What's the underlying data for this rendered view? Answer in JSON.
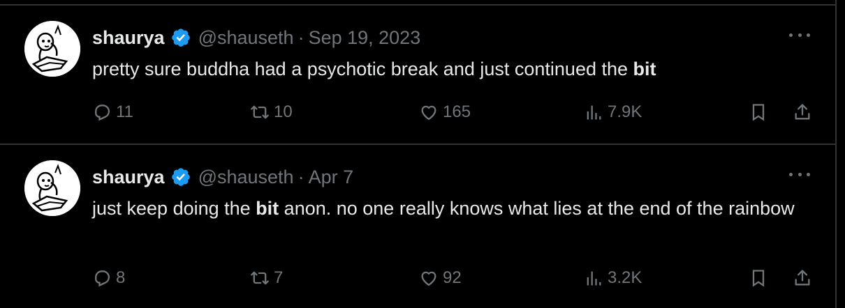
{
  "colors": {
    "background": "#000000",
    "divider": "#2f3336",
    "text_primary": "#e7e9ea",
    "text_secondary": "#71767b",
    "verified_badge": "#1d9bf0"
  },
  "tweets": [
    {
      "author_name": "shaurya",
      "verified": true,
      "handle": "@shauseth",
      "separator": "·",
      "date": "Sep 19, 2023",
      "text_before": "pretty sure buddha had a psychotic break and just continued the ",
      "text_bold": "bit",
      "text_after": "",
      "replies": "11",
      "reposts": "10",
      "likes": "165",
      "views": "7.9K",
      "icons": [
        "avatar",
        "verified-badge-icon",
        "more-options-icon",
        "reply-icon",
        "repost-icon",
        "like-icon",
        "views-icon",
        "bookmark-icon",
        "share-icon"
      ]
    },
    {
      "author_name": "shaurya",
      "verified": true,
      "handle": "@shauseth",
      "separator": "·",
      "date": "Apr 7",
      "text_before": "just keep doing the ",
      "text_bold": "bit",
      "text_after": " anon. no one really knows what lies at the end of the rainbow",
      "replies": "8",
      "reposts": "7",
      "likes": "92",
      "views": "3.2K",
      "icons": [
        "avatar",
        "verified-badge-icon",
        "more-options-icon",
        "reply-icon",
        "repost-icon",
        "like-icon",
        "views-icon",
        "bookmark-icon",
        "share-icon"
      ]
    }
  ]
}
